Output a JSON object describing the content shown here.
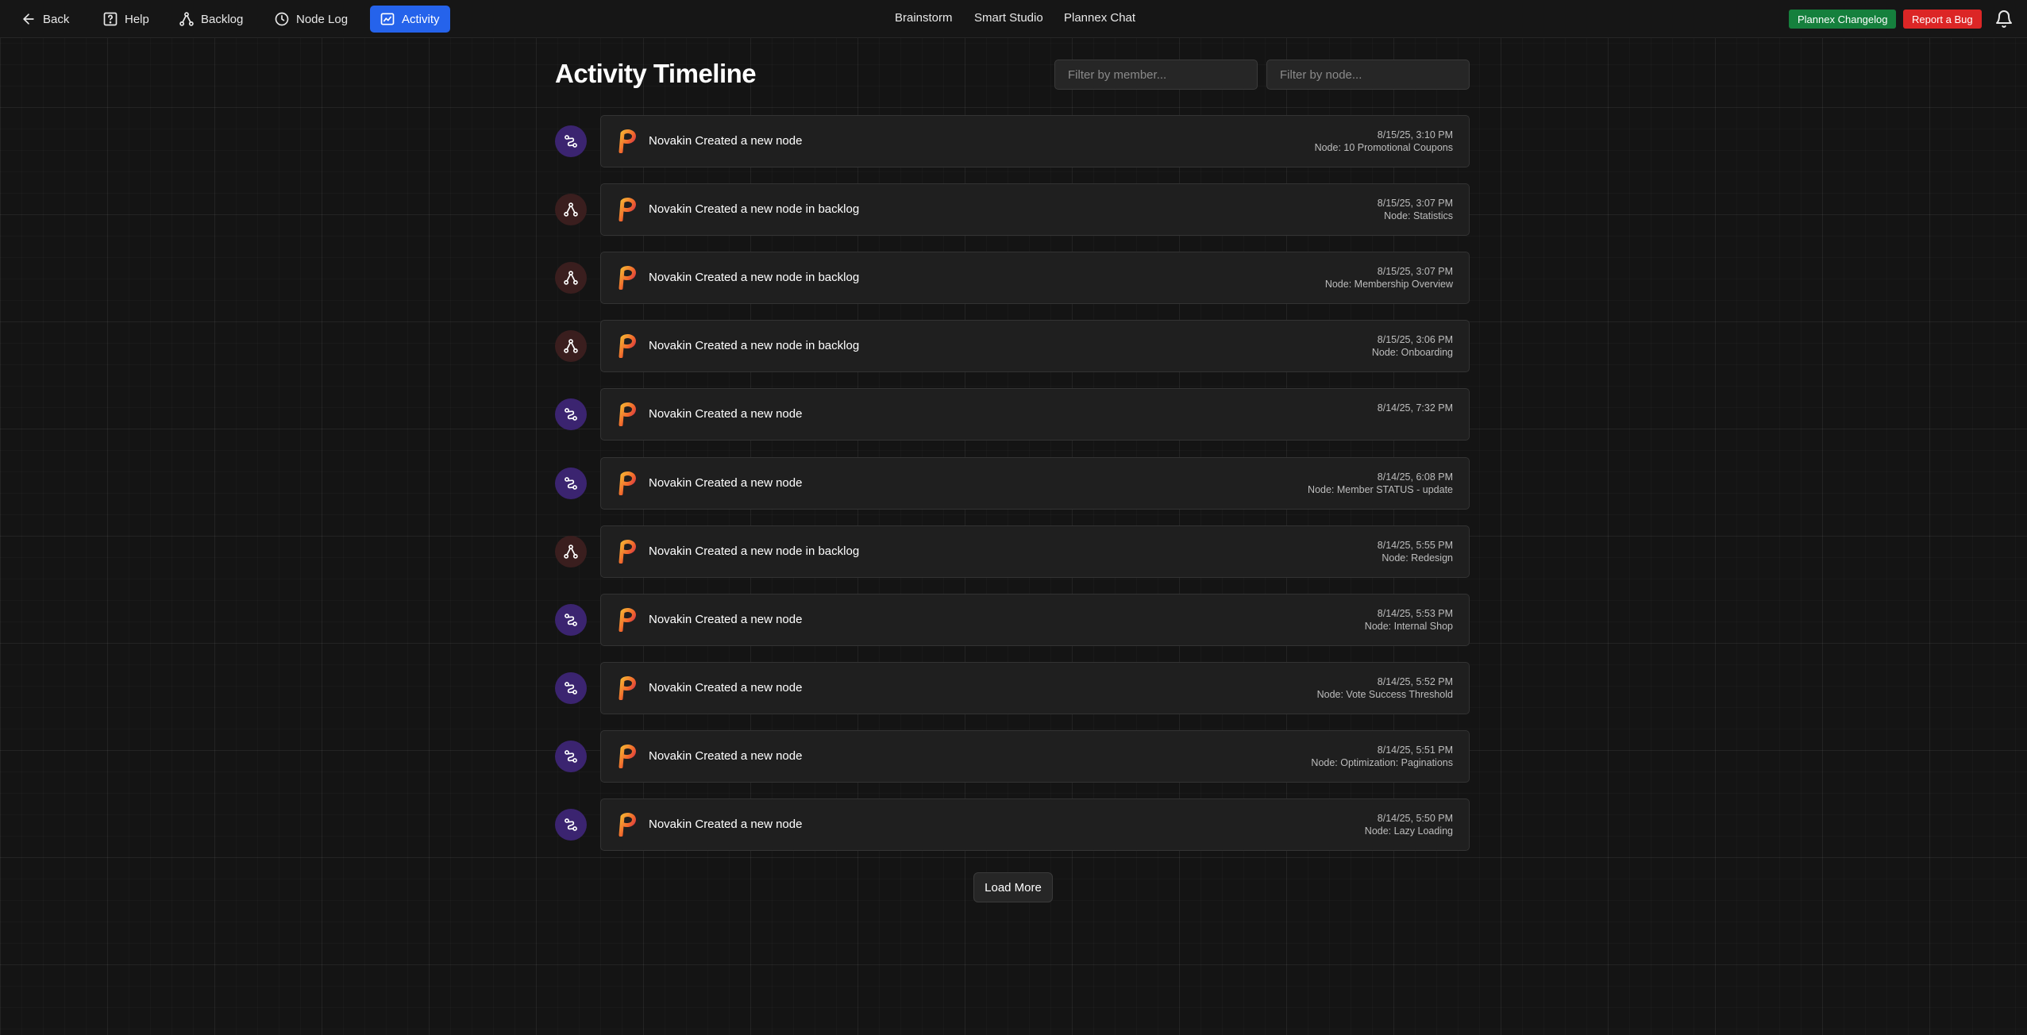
{
  "nav": {
    "back": "Back",
    "help": "Help",
    "backlog": "Backlog",
    "node_log": "Node Log",
    "activity": "Activity",
    "brainstorm": "Brainstorm",
    "smart_studio": "Smart Studio",
    "chat": "Plannex Chat",
    "changelog": "Plannex Changelog",
    "report_bug": "Report a Bug"
  },
  "page": {
    "title": "Activity Timeline",
    "member_filter_placeholder": "Filter by member...",
    "node_filter_placeholder": "Filter by node..."
  },
  "colors": {
    "active_tab": "#2563eb",
    "changelog": "#15803d",
    "report_bug": "#dc2626",
    "brainstorm_icon_bg": "#3b2470",
    "backlog_icon_bg": "#3a1e1e"
  },
  "activities": [
    {
      "type": "brainstorm-icon",
      "text": "Novakin Created a new node",
      "time": "8/15/25, 3:10 PM",
      "node": "Node: 10 Promotional Coupons"
    },
    {
      "type": "backlog-icon",
      "text": "Novakin Created a new node in backlog",
      "time": "8/15/25, 3:07 PM",
      "node": "Node: Statistics"
    },
    {
      "type": "backlog-icon",
      "text": "Novakin Created a new node in backlog",
      "time": "8/15/25, 3:07 PM",
      "node": "Node: Membership Overview"
    },
    {
      "type": "backlog-icon",
      "text": "Novakin Created a new node in backlog",
      "time": "8/15/25, 3:06 PM",
      "node": "Node: Onboarding"
    },
    {
      "type": "brainstorm-icon",
      "text": "Novakin Created a new node",
      "time": "8/14/25, 7:32 PM",
      "node": ""
    },
    {
      "type": "brainstorm-icon",
      "text": "Novakin Created a new node",
      "time": "8/14/25, 6:08 PM",
      "node": "Node: Member STATUS - update"
    },
    {
      "type": "backlog-icon",
      "text": "Novakin Created a new node in backlog",
      "time": "8/14/25, 5:55 PM",
      "node": "Node: Redesign"
    },
    {
      "type": "brainstorm-icon",
      "text": "Novakin Created a new node",
      "time": "8/14/25, 5:53 PM",
      "node": "Node: Internal Shop"
    },
    {
      "type": "brainstorm-icon",
      "text": "Novakin Created a new node",
      "time": "8/14/25, 5:52 PM",
      "node": "Node: Vote Success Threshold"
    },
    {
      "type": "brainstorm-icon",
      "text": "Novakin Created a new node",
      "time": "8/14/25, 5:51 PM",
      "node": "Node: Optimization: Paginations"
    },
    {
      "type": "brainstorm-icon",
      "text": "Novakin Created a new node",
      "time": "8/14/25, 5:50 PM",
      "node": "Node: Lazy Loading"
    }
  ],
  "load_more": "Load More"
}
